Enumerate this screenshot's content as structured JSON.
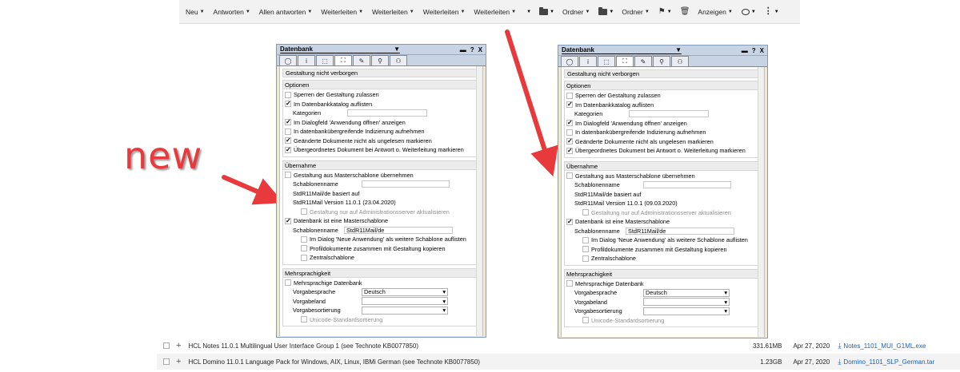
{
  "toolbar": {
    "items": [
      {
        "label": "Neu",
        "icon": ""
      },
      {
        "label": "Antworten",
        "icon": ""
      },
      {
        "label": "Allen antworten",
        "icon": ""
      },
      {
        "label": "Weiterleiten",
        "icon": ""
      },
      {
        "label": "Weiterleiten",
        "icon": ""
      },
      {
        "label": "Weiterleiten",
        "icon": ""
      },
      {
        "label": "Weiterleiten",
        "icon": ""
      }
    ],
    "folder_label_1": "Ordner",
    "folder_label_2": "Ordner",
    "view_label": "Anzeigen"
  },
  "annotation": {
    "text": "new"
  },
  "dialogs": [
    {
      "title": "Datenbank",
      "title_arrow": "▼",
      "controls": [
        "▬",
        "?",
        "X"
      ],
      "tabs": [
        "◯",
        "i",
        "⬚",
        "⛶",
        "✎",
        "⚲",
        "⚇"
      ],
      "hidden_bar": "Gestaltung nicht verborgen",
      "options": {
        "header": "Optionen",
        "rows": [
          {
            "checked": false,
            "text": "Sperren der Gestaltung zulassen"
          },
          {
            "checked": true,
            "text": "Im Datenbankkatalog auflisten"
          },
          {
            "checked": false,
            "text": "Kategorien",
            "field": true
          },
          {
            "checked": true,
            "text": "Im Dialogfeld 'Anwendung öffnen' anzeigen"
          },
          {
            "checked": false,
            "text": "In datenbankübergreifende Indizierung aufnehmen"
          },
          {
            "checked": true,
            "text": "Geänderte Dokumente nicht als ungelesen markieren"
          },
          {
            "checked": true,
            "text": "Übergeordnetes Dokument bei Antwort o. Weiterleitung markieren"
          }
        ]
      },
      "inheritance": {
        "header": "Übernahme",
        "inherit_check": "Gestaltung aus Masterschablone übernehmen",
        "template_name_label": "Schablonenname",
        "based_on": "StdR11Mail/de basiert auf",
        "version": "StdR11Mail Version 11.0.1 (23.04.2020)",
        "admin_only": "Gestaltung nur auf Administrationsserver aktualisieren",
        "is_master": "Datenbank ist eine Masterschablone",
        "master_name_label": "Schablonenname",
        "master_name_value": "StdR11Mail/de",
        "list_in_dialog": "Im Dialog 'Neue Anwendung' als weitere Schablone auflisten",
        "copy_profiles": "Profildokumente zusammen mit Gestaltung kopieren",
        "central": "Zentralschablone"
      },
      "multilingual": {
        "header": "Mehrsprachigkeit",
        "multi_check": "Mehrsprachige Datenbank",
        "lang_label": "Vorgabesprache",
        "lang_value": "Deutsch",
        "country_label": "Vorgabeland",
        "country_value": "",
        "sort_label": "Vorgabesortierung",
        "sort_value": "",
        "unicode": "Unicode-Standardsortierung"
      }
    },
    {
      "title": "Datenbank",
      "title_arrow": "▼",
      "controls": [
        "▬",
        "?",
        "X"
      ],
      "tabs": [
        "◯",
        "i",
        "⬚",
        "⛶",
        "✎",
        "⚲",
        "⚇"
      ],
      "hidden_bar": "Gestaltung nicht verborgen",
      "options": {
        "header": "Optionen",
        "rows": [
          {
            "checked": false,
            "text": "Sperren der Gestaltung zulassen"
          },
          {
            "checked": true,
            "text": "Im Datenbankkatalog auflisten"
          },
          {
            "checked": false,
            "text": "Kategorien",
            "field": true
          },
          {
            "checked": true,
            "text": "Im Dialogfeld 'Anwendung öffnen' anzeigen"
          },
          {
            "checked": false,
            "text": "In datenbankübergreifende Indizierung aufnehmen"
          },
          {
            "checked": true,
            "text": "Geänderte Dokumente nicht als ungelesen markieren"
          },
          {
            "checked": true,
            "text": "Übergeordnetes Dokument bei Antwort o. Weiterleitung markieren"
          }
        ]
      },
      "inheritance": {
        "header": "Übernahme",
        "inherit_check": "Gestaltung aus Masterschablone übernehmen",
        "template_name_label": "Schablonenname",
        "based_on": "StdR11Mail/de basiert auf",
        "version": "StdR11Mail Version 11.0.1 (09.03.2020)",
        "admin_only": "Gestaltung nur auf Administrationsserver aktualisieren",
        "is_master": "Datenbank ist eine Masterschablone",
        "master_name_label": "Schablonenname",
        "master_name_value": "StdR11Mail/de",
        "list_in_dialog": "Im Dialog 'Neue Anwendung' als weitere Schablone auflisten",
        "copy_profiles": "Profildokumente zusammen mit Gestaltung kopieren",
        "central": "Zentralschablone"
      },
      "multilingual": {
        "header": "Mehrsprachigkeit",
        "multi_check": "Mehrsprachige Datenbank",
        "lang_label": "Vorgabesprache",
        "lang_value": "Deutsch",
        "country_label": "Vorgabeland",
        "country_value": "",
        "sort_label": "Vorgabesortierung",
        "sort_value": "",
        "unicode": "Unicode-Standardsortierung"
      }
    }
  ],
  "downloads": [
    {
      "name": "HCL Notes 11.0.1 Multilingual User Interface Group 1 (see Technote KB0077850)",
      "size": "331.61MB",
      "date": "Apr 27, 2020",
      "file": "Notes_1101_MUI_G1ML.exe"
    },
    {
      "name": "HCL Domino 11.0.1 Language Pack for Windows, AIX, Linux, IBMi German (see Technote KB0077850)",
      "size": "1.23GB",
      "date": "Apr 27, 2020",
      "file": "Domino_1101_SLP_German.tar"
    }
  ],
  "colors": {
    "arrow": "#e8393c",
    "link": "#1a5fb4"
  }
}
